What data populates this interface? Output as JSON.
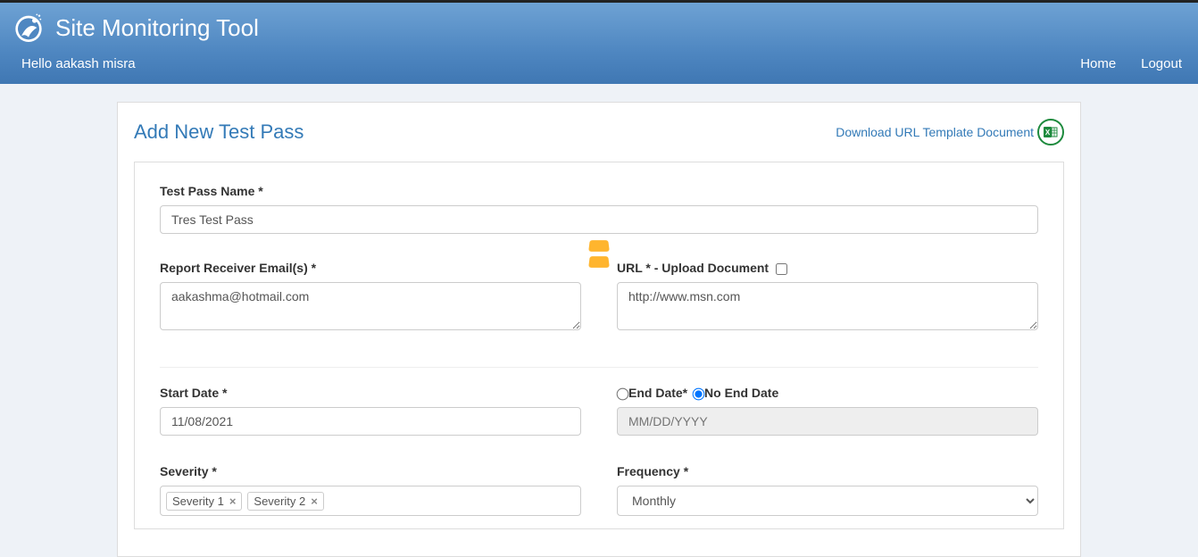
{
  "header": {
    "app_title": "Site Monitoring Tool",
    "greeting": "Hello aakash misra",
    "nav": {
      "home": "Home",
      "logout": "Logout"
    }
  },
  "page": {
    "title": "Add New Test Pass",
    "download_label": "Download URL Template Document",
    "excel_badge": "X"
  },
  "form": {
    "test_pass_name_label": "Test Pass Name *",
    "test_pass_name_value": "Tres Test Pass",
    "report_email_label": "Report Receiver Email(s) *",
    "report_email_value": "aakashma@hotmail.com",
    "url_label": "URL * - Upload Document",
    "url_value": "http://www.msn.com",
    "start_date_label": "Start Date *",
    "start_date_value": "11/08/2021",
    "end_date_label": "End Date*",
    "no_end_date_label": "No End Date",
    "end_date_placeholder": "MM/DD/YYYY",
    "severity_label": "Severity *",
    "severity_tags": [
      "Severity 1",
      "Severity 2"
    ],
    "frequency_label": "Frequency *",
    "frequency_value": "Monthly"
  }
}
